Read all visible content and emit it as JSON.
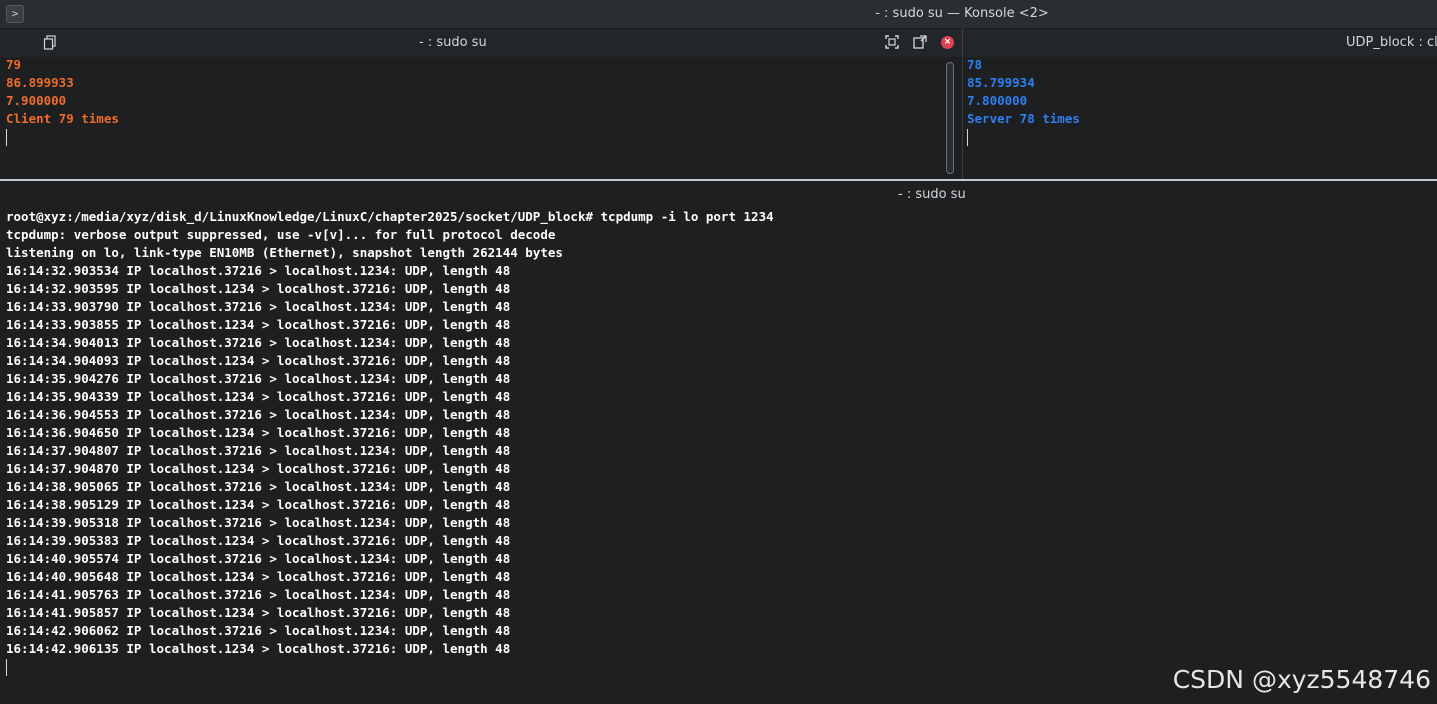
{
  "window": {
    "title": "- : sudo su — Konsole <2>",
    "app_icon": "konsole-icon"
  },
  "pane_client": {
    "title": "- : sudo su",
    "icons": [
      "copy-icon",
      "maximize-icon",
      "detach-icon",
      "close-icon"
    ],
    "lines": [
      "79",
      "86.899933",
      "7.900000",
      "Client 79 times"
    ],
    "text_color": "#ee6c2b"
  },
  "pane_server": {
    "title": "UDP_block : cli",
    "lines": [
      "78",
      "85.799934",
      "7.800000",
      "Server 78 times"
    ],
    "text_color": "#2f7ff0"
  },
  "pane_tcpdump": {
    "title": "- : sudo su",
    "prompt": "root@xyz:/media/xyz/disk_d/LinuxKnowledge/LinuxC/chapter2025/socket/UDP_block# tcpdump -i lo port 1234",
    "info": [
      "tcpdump: verbose output suppressed, use -v[v]... for full protocol decode",
      "listening on lo, link-type EN10MB (Ethernet), snapshot length 262144 bytes"
    ],
    "packets": [
      "16:14:32.903534 IP localhost.37216 > localhost.1234: UDP, length 48",
      "16:14:32.903595 IP localhost.1234 > localhost.37216: UDP, length 48",
      "16:14:33.903790 IP localhost.37216 > localhost.1234: UDP, length 48",
      "16:14:33.903855 IP localhost.1234 > localhost.37216: UDP, length 48",
      "16:14:34.904013 IP localhost.37216 > localhost.1234: UDP, length 48",
      "16:14:34.904093 IP localhost.1234 > localhost.37216: UDP, length 48",
      "16:14:35.904276 IP localhost.37216 > localhost.1234: UDP, length 48",
      "16:14:35.904339 IP localhost.1234 > localhost.37216: UDP, length 48",
      "16:14:36.904553 IP localhost.37216 > localhost.1234: UDP, length 48",
      "16:14:36.904650 IP localhost.1234 > localhost.37216: UDP, length 48",
      "16:14:37.904807 IP localhost.37216 > localhost.1234: UDP, length 48",
      "16:14:37.904870 IP localhost.1234 > localhost.37216: UDP, length 48",
      "16:14:38.905065 IP localhost.37216 > localhost.1234: UDP, length 48",
      "16:14:38.905129 IP localhost.1234 > localhost.37216: UDP, length 48",
      "16:14:39.905318 IP localhost.37216 > localhost.1234: UDP, length 48",
      "16:14:39.905383 IP localhost.1234 > localhost.37216: UDP, length 48",
      "16:14:40.905574 IP localhost.37216 > localhost.1234: UDP, length 48",
      "16:14:40.905648 IP localhost.1234 > localhost.37216: UDP, length 48",
      "16:14:41.905763 IP localhost.37216 > localhost.1234: UDP, length 48",
      "16:14:41.905857 IP localhost.1234 > localhost.37216: UDP, length 48",
      "16:14:42.906062 IP localhost.37216 > localhost.1234: UDP, length 48",
      "16:14:42.906135 IP localhost.1234 > localhost.37216: UDP, length 48"
    ]
  },
  "watermark": "CSDN @xyz5548746"
}
